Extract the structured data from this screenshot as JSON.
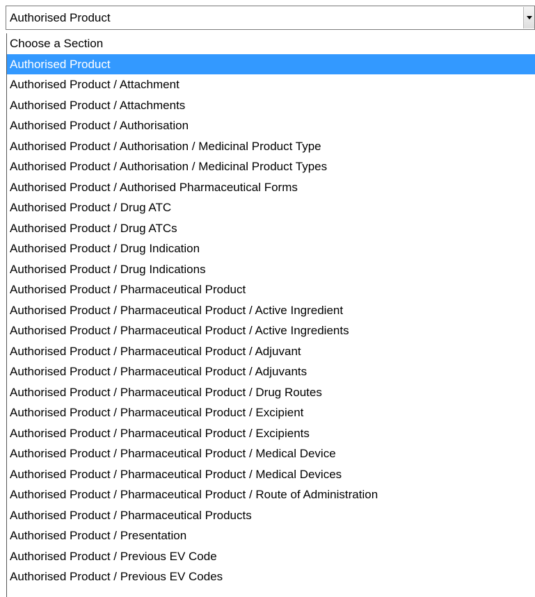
{
  "select": {
    "value": "Authorised Product"
  },
  "options": [
    "Choose a Section",
    "Authorised Product",
    "Authorised Product / Attachment",
    "Authorised Product / Attachments",
    "Authorised Product / Authorisation",
    "Authorised Product / Authorisation / Medicinal Product Type",
    "Authorised Product / Authorisation / Medicinal Product Types",
    "Authorised Product / Authorised Pharmaceutical Forms",
    "Authorised Product / Drug ATC",
    "Authorised Product / Drug ATCs",
    "Authorised Product / Drug Indication",
    "Authorised Product / Drug Indications",
    "Authorised Product / Pharmaceutical Product",
    "Authorised Product / Pharmaceutical Product / Active Ingredient",
    "Authorised Product / Pharmaceutical Product / Active Ingredients",
    "Authorised Product / Pharmaceutical Product / Adjuvant",
    "Authorised Product / Pharmaceutical Product / Adjuvants",
    "Authorised Product / Pharmaceutical Product / Drug Routes",
    "Authorised Product / Pharmaceutical Product / Excipient",
    "Authorised Product / Pharmaceutical Product / Excipients",
    "Authorised Product / Pharmaceutical Product / Medical Device",
    "Authorised Product / Pharmaceutical Product / Medical Devices",
    "Authorised Product / Pharmaceutical Product / Route of Administration",
    "Authorised Product / Pharmaceutical Products",
    "Authorised Product / Presentation",
    "Authorised Product / Previous EV Code",
    "Authorised Product / Previous EV Codes"
  ],
  "selected_index": 1,
  "colors": {
    "highlight": "#3399ff",
    "highlight_text": "#ffffff"
  }
}
